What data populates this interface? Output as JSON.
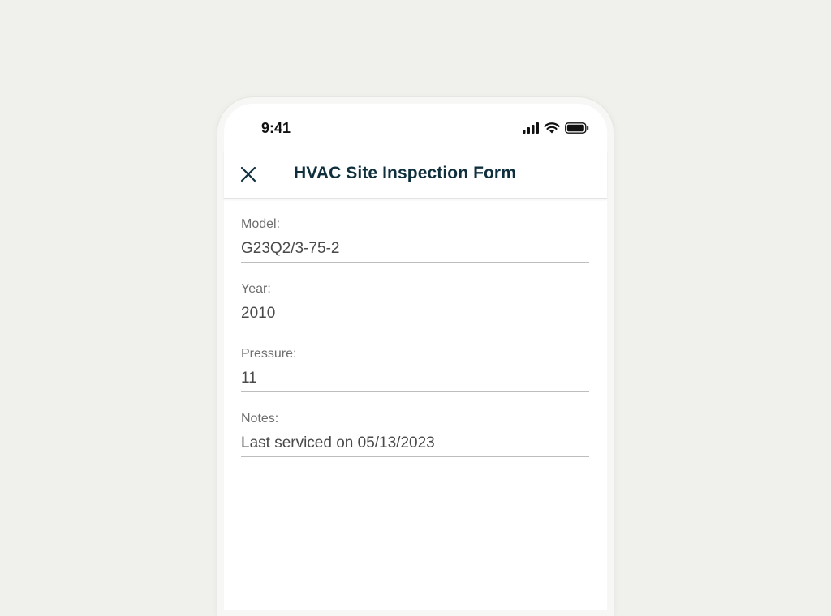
{
  "status_bar": {
    "time": "9:41",
    "icons": [
      "signal-icon",
      "wifi-icon",
      "battery-icon"
    ]
  },
  "header": {
    "title": "HVAC Site Inspection Form",
    "close_icon": "close-icon"
  },
  "form": {
    "fields": [
      {
        "label": "Model:",
        "value": "G23Q2/3-75-2"
      },
      {
        "label": "Year:",
        "value": "2010"
      },
      {
        "label": "Pressure:",
        "value": "11"
      },
      {
        "label": "Notes:",
        "value": "Last serviced on 05/13/2023"
      }
    ]
  },
  "colors": {
    "background": "#f0f0ec",
    "title": "#0f2f3d",
    "label": "#6e6e6e",
    "value": "#4a4a4a"
  }
}
